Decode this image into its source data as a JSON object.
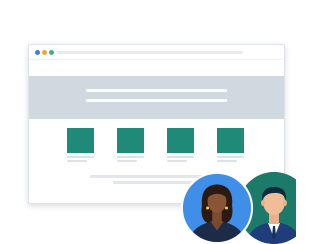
{
  "illustration": {
    "colors": {
      "hero": "#d2d8e0",
      "card_thumb": "#1f8a78",
      "avatar_left_bg": "#3f8fe8",
      "avatar_right_bg": "#1b7a6a",
      "window_dots": [
        "#3b7ddd",
        "#f2a33a",
        "#3fb27f"
      ]
    },
    "cards": [
      {
        "id": "card-1"
      },
      {
        "id": "card-2"
      },
      {
        "id": "card-3"
      },
      {
        "id": "card-4"
      }
    ],
    "avatars": [
      {
        "id": "woman-avatar",
        "icon": "person-woman-icon"
      },
      {
        "id": "man-avatar",
        "icon": "person-man-icon"
      }
    ]
  }
}
